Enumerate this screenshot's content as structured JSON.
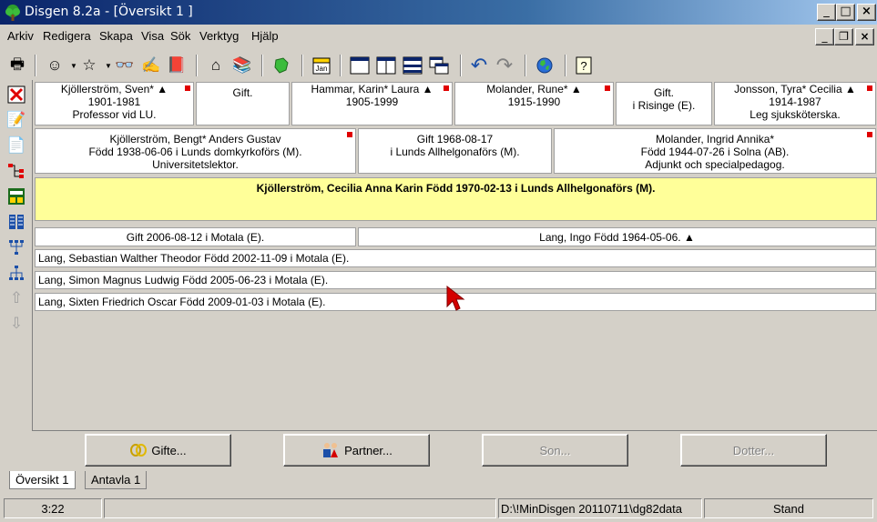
{
  "window": {
    "title": "Disgen 8.2a - [Översikt 1 ]",
    "minimize": "_",
    "maximize": "□",
    "close": "×"
  },
  "mdi": {
    "minimize": "_",
    "restore": "❐",
    "close": "×"
  },
  "menu": [
    "Arkiv",
    "Redigera",
    "Skapa",
    "Visa",
    "Sök",
    "Verktyg",
    "Hjälp"
  ],
  "toolbar": {
    "calendar_label": "Jan"
  },
  "grandparents": [
    {
      "l1": "Kjöllerström, Sven* ▲",
      "l2": "1901-1981",
      "l3": "Professor vid LU.",
      "flag": true
    },
    {
      "l1": "Gift.",
      "l2": "",
      "l3": "",
      "flag": false
    },
    {
      "l1": "Hammar, Karin* Laura ▲",
      "l2": "1905-1999",
      "l3": "",
      "flag": true
    },
    {
      "l1": "Molander, Rune* ▲",
      "l2": "1915-1990",
      "l3": "",
      "flag": true
    },
    {
      "l1": "Gift.",
      "l2": "i Risinge (E).",
      "l3": "",
      "flag": false
    },
    {
      "l1": "Jonsson, Tyra* Cecilia ▲",
      "l2": "1914-1987",
      "l3": "Leg sjuksköterska.",
      "flag": true
    }
  ],
  "parents": [
    {
      "l1": "Kjöllerström, Bengt* Anders Gustav",
      "l2": "Född 1938-06-06 i Lunds domkyrkoförs (M).",
      "l3": "Universitetslektor.",
      "flag": true
    },
    {
      "l1": "Gift 1968-08-17",
      "l2": "i Lunds Allhelgonaförs (M).",
      "l3": "",
      "flag": false
    },
    {
      "l1": "Molander, Ingrid Annika*",
      "l2": "Född 1944-07-26 i Solna (AB).",
      "l3": "Adjunkt och specialpedagog.",
      "flag": true
    }
  ],
  "main_person": {
    "name": "Kjöllerström, Cecilia Anna Karin",
    "born": "Född 1970-02-13 i Lunds Allhelgonaförs (M)."
  },
  "marriage": {
    "text": "Gift 2006-08-12 i Motala (E).",
    "partner": "Lang, Ingo Född 1964-05-06. ▲"
  },
  "children": [
    "Lang, Sebastian Walther Theodor Född 2002-11-09 i Motala (E).",
    "Lang, Simon Magnus Ludwig Född 2005-06-23 i Motala (E).",
    "Lang, Sixten Friedrich Oscar Född 2009-01-03 i Motala (E)."
  ],
  "buttons": {
    "gifte": "Gifte...",
    "partner": "Partner...",
    "son": "Son...",
    "dotter": "Dotter..."
  },
  "tabs": [
    "Översikt 1",
    "Antavla 1"
  ],
  "status": {
    "time": "3:22",
    "path": "D:\\!MinDisgen 20110711\\dg82data",
    "mode": "Stand"
  },
  "colors": {
    "highlight": "#ffff99",
    "flag": "#e00000",
    "titlebar": "#0a246a"
  }
}
